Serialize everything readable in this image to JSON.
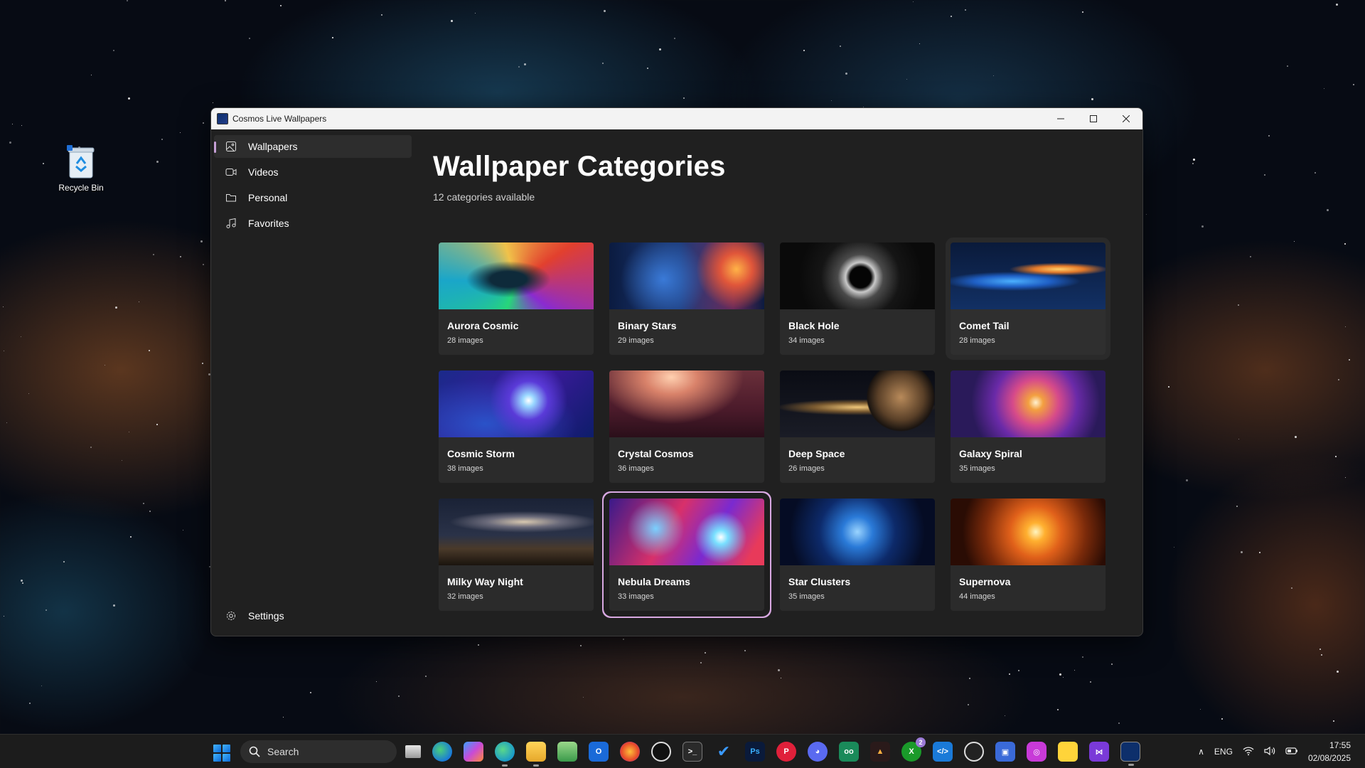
{
  "desktop": {
    "recycle_bin_label": "Recycle Bin"
  },
  "window": {
    "title": "Cosmos Live Wallpapers"
  },
  "nav": {
    "items": [
      {
        "label": "Wallpapers",
        "icon": "image-icon"
      },
      {
        "label": "Videos",
        "icon": "video-icon"
      },
      {
        "label": "Personal",
        "icon": "folder-icon"
      },
      {
        "label": "Favorites",
        "icon": "music-note-icon"
      }
    ],
    "settings_label": "Settings"
  },
  "main": {
    "title": "Wallpaper Categories",
    "subtitle": "12 categories available",
    "categories": [
      {
        "name": "Aurora Cosmic",
        "count": "28 images"
      },
      {
        "name": "Binary Stars",
        "count": "29 images"
      },
      {
        "name": "Black Hole",
        "count": "34 images"
      },
      {
        "name": "Comet Tail",
        "count": "28 images"
      },
      {
        "name": "Cosmic Storm",
        "count": "38 images"
      },
      {
        "name": "Crystal Cosmos",
        "count": "36 images"
      },
      {
        "name": "Deep Space",
        "count": "26 images"
      },
      {
        "name": "Galaxy Spiral",
        "count": "35 images"
      },
      {
        "name": "Milky Way Night",
        "count": "32 images"
      },
      {
        "name": "Nebula Dreams",
        "count": "33 images"
      },
      {
        "name": "Star Clusters",
        "count": "35 images"
      },
      {
        "name": "Supernova",
        "count": "44 images"
      }
    ]
  },
  "taskbar": {
    "search_placeholder": "Search",
    "xbox_badge": "2",
    "language": "ENG",
    "time": "17:55",
    "date": "02/08/2025"
  },
  "colors": {
    "accent": "#c7a0d7",
    "selected_border": "#d8a8e2",
    "window_bg": "#202020",
    "card_bg": "#2b2b2b"
  }
}
